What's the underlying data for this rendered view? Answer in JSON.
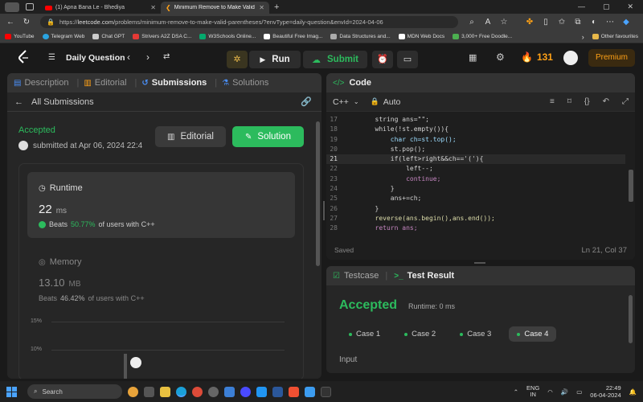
{
  "browser": {
    "tabs": [
      {
        "title": "(1) Apna Bana Le - Bhediya",
        "active": false
      },
      {
        "title": "Minimum Remove to Make Valid",
        "active": true
      }
    ],
    "url_prefix": "https://",
    "url_host": "leetcode.com",
    "url_path": "/problems/minimum-remove-to-make-valid-parentheses/?envType=daily-question&envId=2024-04-06",
    "bookmarks": [
      {
        "label": "YouTube",
        "color": "#ff0000"
      },
      {
        "label": "Telegram Web",
        "color": "#2aa3e0"
      },
      {
        "label": "Chat GPT",
        "color": "#cccccc"
      },
      {
        "label": "Strivers A2Z DSA C...",
        "color": "#e53935"
      },
      {
        "label": "W3Schools Online...",
        "color": "#04aa6d"
      },
      {
        "label": "Beautiful Free Imag...",
        "color": "#ffffff"
      },
      {
        "label": "Data Structures and...",
        "color": "#aaaaaa"
      },
      {
        "label": "MDN Web Docs",
        "color": "#ffffff"
      },
      {
        "label": "3,000+ Free Doodle...",
        "color": "#4caf50"
      }
    ],
    "other_favourites": "Other favourites"
  },
  "lc_nav": {
    "daily_question": "Daily Question",
    "run": "Run",
    "submit": "Submit",
    "streak": "131",
    "premium": "Premium"
  },
  "left_pane": {
    "tabs": [
      "Description",
      "Editorial",
      "Submissions",
      "Solutions"
    ],
    "active_tab": "Submissions",
    "all_submissions": "All Submissions",
    "status": "Accepted",
    "submitted_at": "submitted at Apr 06, 2024 22:4",
    "editorial_btn": "Editorial",
    "solution_btn": "Solution",
    "runtime": {
      "label": "Runtime",
      "value": "22",
      "unit": "ms",
      "beats_prefix": "Beats",
      "beats_pct": "50.77%",
      "beats_suffix": "of users with C++"
    },
    "memory": {
      "label": "Memory",
      "value": "13.10",
      "unit": "MB",
      "beats_prefix": "Beats",
      "beats_pct": "46.42%",
      "beats_suffix": "of users with C++"
    },
    "chart_ticks": [
      "15%",
      "10%"
    ]
  },
  "code_pane": {
    "title": "Code",
    "language": "C++",
    "mode": "Auto",
    "saved": "Saved",
    "cursor": "Ln 21, Col 37",
    "lines": [
      {
        "n": "17",
        "text": "        string ans=\"\";"
      },
      {
        "n": "18",
        "text": "        while(!st.empty()){"
      },
      {
        "n": "19",
        "text": "            char ch=st.top();"
      },
      {
        "n": "20",
        "text": "            st.pop();"
      },
      {
        "n": "21",
        "text": "            if(left>right&&ch=='('){"
      },
      {
        "n": "22",
        "text": "                left--;"
      },
      {
        "n": "23",
        "text": "                continue;"
      },
      {
        "n": "24",
        "text": "            }"
      },
      {
        "n": "25",
        "text": "            ans+=ch;"
      },
      {
        "n": "26",
        "text": "        }"
      },
      {
        "n": "27",
        "text": "        reverse(ans.begin(),ans.end());"
      },
      {
        "n": "28",
        "text": "        return ans;"
      }
    ]
  },
  "test_pane": {
    "testcase_tab": "Testcase",
    "result_tab": "Test Result",
    "status": "Accepted",
    "runtime": "Runtime: 0 ms",
    "cases": [
      "Case 1",
      "Case 2",
      "Case 3",
      "Case 4"
    ],
    "active_case": "Case 4",
    "input_label": "Input"
  },
  "taskbar": {
    "search": "Search",
    "lang": "ENG",
    "region": "IN",
    "time": "22:49",
    "date": "06-04-2024"
  }
}
